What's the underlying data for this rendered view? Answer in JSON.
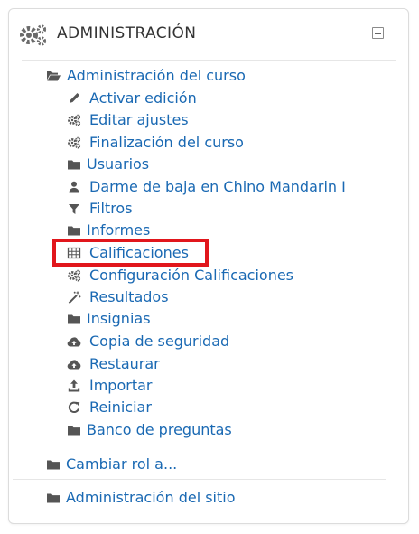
{
  "block": {
    "title": "ADMINISTRACIÓN",
    "header_icon": "gears-icon",
    "collapse_icon": "collapse-icon"
  },
  "course_admin": {
    "label": "Administración del curso",
    "icon": "folder-open-icon",
    "items": [
      {
        "label": "Activar edición",
        "icon": "pencil-icon"
      },
      {
        "label": "Editar ajustes",
        "icon": "gear-icon"
      },
      {
        "label": "Finalización del curso",
        "icon": "gear-icon"
      },
      {
        "label": "Usuarios",
        "icon": "folder-icon"
      },
      {
        "label": "Darme de baja en Chino Mandarin I",
        "icon": "user-icon"
      },
      {
        "label": "Filtros",
        "icon": "filter-icon"
      },
      {
        "label": "Informes",
        "icon": "folder-icon"
      },
      {
        "label": "Calificaciones",
        "icon": "table-icon",
        "highlighted": true
      },
      {
        "label": "Configuración Calificaciones",
        "icon": "gear-icon"
      },
      {
        "label": "Resultados",
        "icon": "magic-wand-icon"
      },
      {
        "label": "Insignias",
        "icon": "folder-icon"
      },
      {
        "label": "Copia de seguridad",
        "icon": "cloud-upload-icon"
      },
      {
        "label": "Restaurar",
        "icon": "cloud-upload-icon"
      },
      {
        "label": "Importar",
        "icon": "upload-icon"
      },
      {
        "label": "Reiniciar",
        "icon": "refresh-icon"
      },
      {
        "label": "Banco de preguntas",
        "icon": "folder-icon"
      }
    ]
  },
  "switch_role": {
    "label": "Cambiar rol a...",
    "icon": "folder-icon"
  },
  "site_admin": {
    "label": "Administración del sitio",
    "icon": "folder-icon"
  },
  "colors": {
    "link": "#1a69b3",
    "icon": "#555555",
    "highlight": "#e1161c"
  }
}
